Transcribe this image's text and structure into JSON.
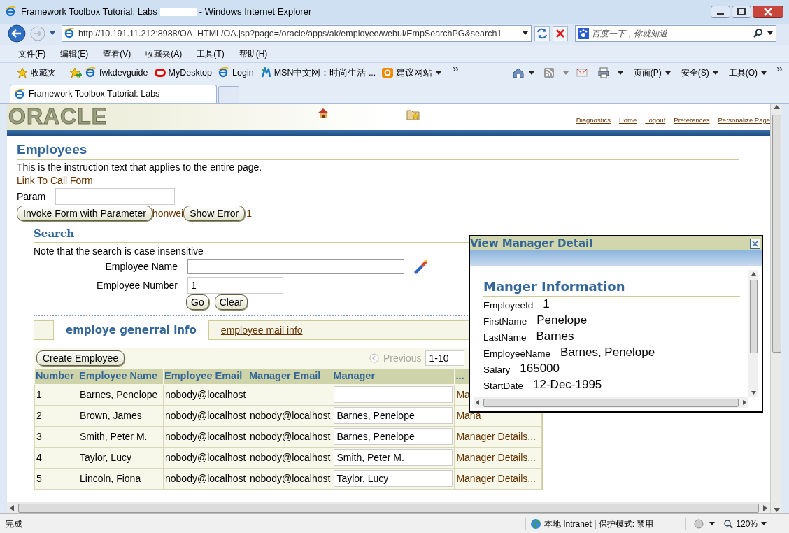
{
  "window": {
    "title_start": "Framework Toolbox Tutorial: Labs",
    "title_end": "- Windows Internet Explorer"
  },
  "address_bar": {
    "url": "http://10.191.11.212:8988/OA_HTML/OA.jsp?page=/oracle/apps/ak/employee/webui/EmpSearchPG&search1"
  },
  "search_box": {
    "placeholder": "百度一下，你就知道"
  },
  "menu": [
    "文件(F)",
    "编辑(E)",
    "查看(V)",
    "收藏夹(A)",
    "工具(T)",
    "帮助(H)"
  ],
  "favorites_bar": {
    "label": "收藏夹",
    "links": [
      {
        "label": "fwkdevguide",
        "kind": "page"
      },
      {
        "label": "MyDesktop",
        "kind": "oracle"
      },
      {
        "label": "Login",
        "kind": "page"
      },
      {
        "label": "MSN中文网：时尚生活 ...",
        "kind": "msn"
      },
      {
        "label": "建议网站",
        "kind": "suggest"
      }
    ]
  },
  "command_bar": [
    "页面(P)",
    "安全(S)",
    "工具(O)"
  ],
  "tabs": [
    {
      "label": "Framework Toolbox Tutorial: Labs",
      "selected": true
    }
  ],
  "logo": "ORACLE",
  "global_links": [
    "Diagnostics",
    "Home",
    "Logout",
    "Preferences",
    "Personalize Page"
  ],
  "page": {
    "title": "Employees",
    "instruction": "This is the instruction text that applies to the entire page.",
    "form_link": "Link To Call Form",
    "param_label": "Param",
    "invoke_button": "Invoke Form with Parameter",
    "user_link": "honwei",
    "error_button": "Show Error",
    "count_link": "1"
  },
  "search": {
    "title": "Search",
    "note": "Note that the search is case insensitive",
    "fields": [
      {
        "label": "Employee Name",
        "kind": "lov"
      },
      {
        "label": "Employee Number",
        "value": "1",
        "kind": "text"
      }
    ],
    "buttons": [
      "Go",
      "Clear"
    ]
  },
  "sub_tabs": [
    {
      "label": "employe generral info",
      "selected": true
    },
    {
      "label": "employee mail info",
      "selected": false
    }
  ],
  "table": {
    "create_button": "Create Employee",
    "previous": "Previous",
    "range": "1-10",
    "columns": [
      "Number",
      "Employee Name",
      "Employee Email",
      "Manager Email",
      "Manager",
      "..."
    ],
    "rows": [
      {
        "number": "1",
        "name": "Barnes, Penelope",
        "email": "nobody@localhost",
        "manager": "",
        "details": "Ma"
      },
      {
        "number": "2",
        "name": "Brown, James",
        "email": "nobody@localhost",
        "manager_email": "nobody@localhost",
        "manager": "Barnes, Penelope",
        "details": "Mana"
      },
      {
        "number": "3",
        "name": "Smith, Peter M.",
        "email": "nobody@localhost",
        "manager_email": "nobody@localhost",
        "manager": "Barnes, Penelope",
        "details": "Manager Details..."
      },
      {
        "number": "4",
        "name": "Taylor, Lucy",
        "email": "nobody@localhost",
        "manager_email": "nobody@localhost",
        "manager": "Smith, Peter M.",
        "details": "Manager Details..."
      },
      {
        "number": "5",
        "name": "Lincoln, Fiona",
        "email": "nobody@localhost",
        "manager_email": "nobody@localhost",
        "manager": "Taylor, Lucy",
        "details": "Manager Details..."
      }
    ]
  },
  "popup": {
    "title": "View Manager Detail",
    "heading": "Manger Information",
    "fields": [
      {
        "label": "EmployeeId",
        "value": "1"
      },
      {
        "label": "FirstName",
        "value": "Penelope"
      },
      {
        "label": "LastName",
        "value": "Barnes"
      },
      {
        "label": "EmployeeName",
        "value": "Barnes, Penelope"
      },
      {
        "label": "Salary",
        "value": "165000"
      },
      {
        "label": "StartDate",
        "value": "12-Dec-1995"
      }
    ]
  },
  "status_bar": {
    "text": "完成",
    "zone": "本地 Intranet | 保护模式: 禁用",
    "zoom": "120%"
  }
}
